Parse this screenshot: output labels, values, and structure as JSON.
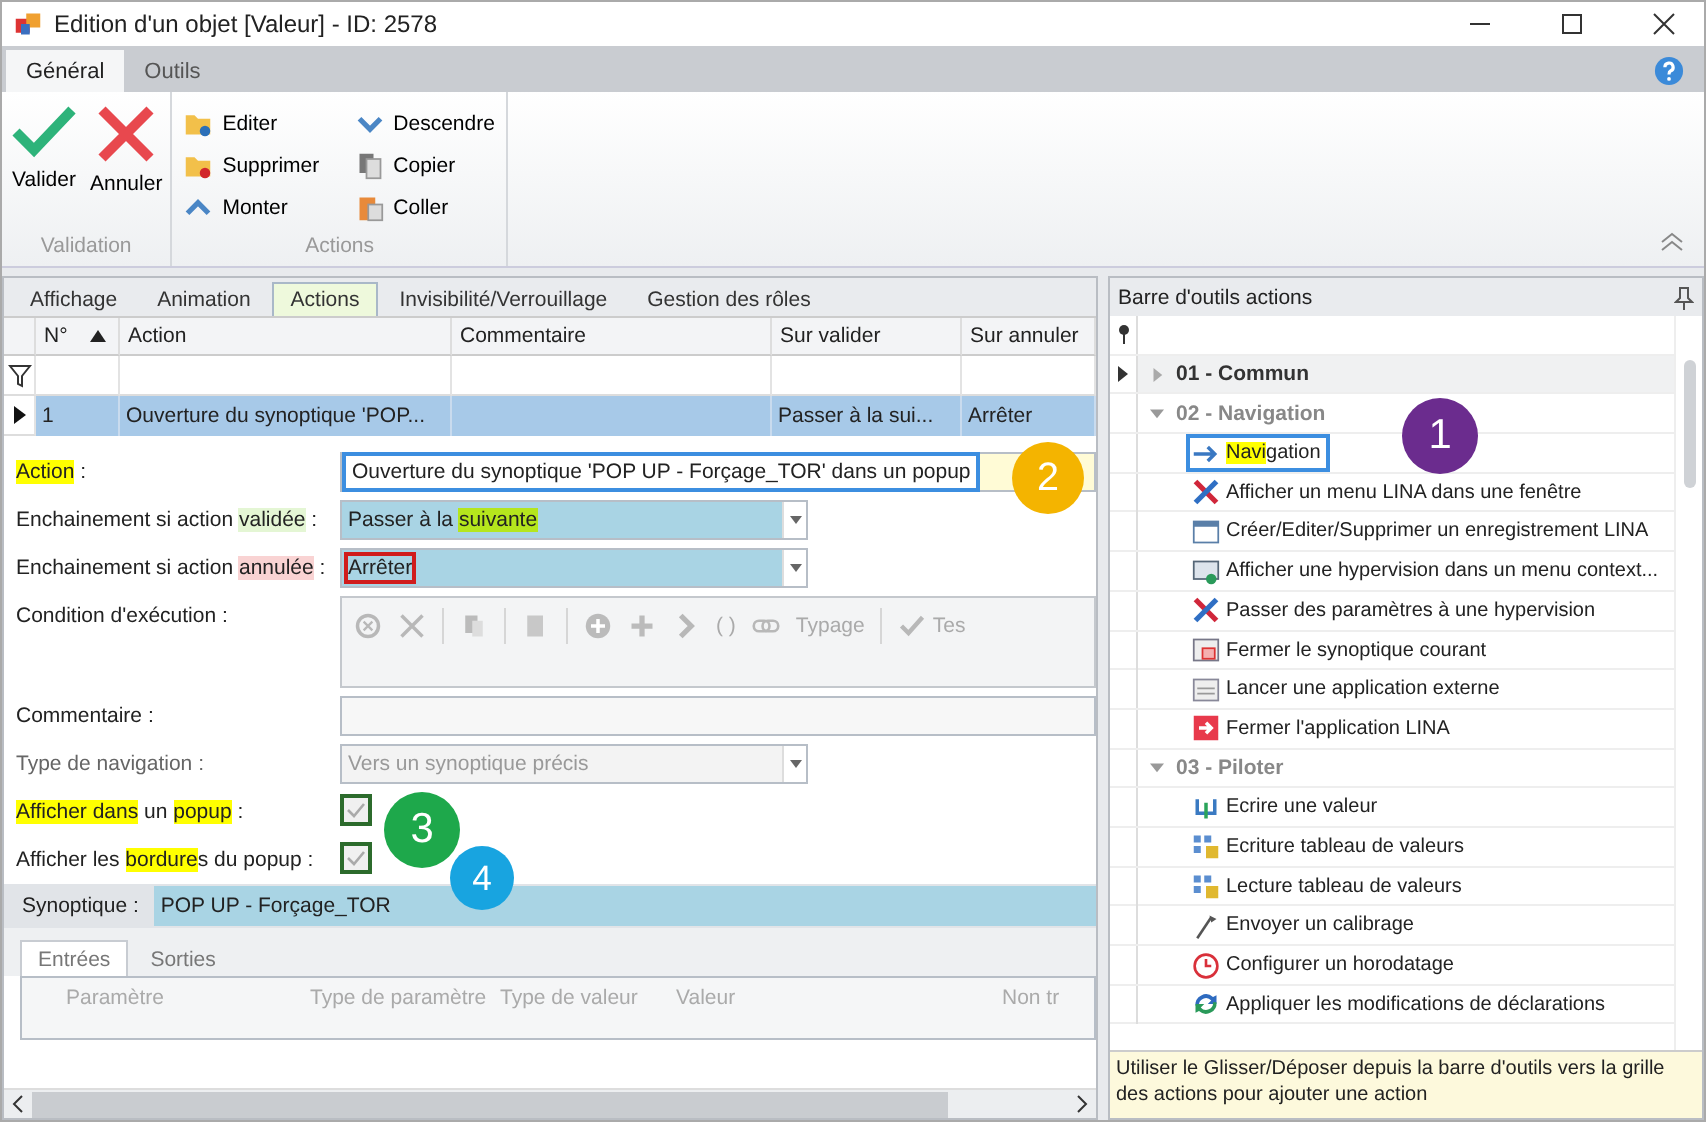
{
  "window": {
    "title": "Edition d'un objet [Valeur] - ID: 2578"
  },
  "ribbon": {
    "tabs": [
      {
        "label": "Général",
        "selected": true
      },
      {
        "label": "Outils",
        "selected": false
      }
    ],
    "groups": [
      {
        "label": "Validation",
        "kind": "large",
        "buttons": [
          {
            "label": "Valider",
            "kind": "check"
          },
          {
            "label": "Annuler",
            "kind": "cross"
          }
        ]
      },
      {
        "label": "Actions",
        "kind": "small",
        "buttons": [
          {
            "label": "Editer",
            "kind": "edit"
          },
          {
            "label": "Supprimer",
            "kind": "delete"
          },
          {
            "label": "Monter",
            "kind": "up"
          },
          {
            "label": "Descendre",
            "kind": "down"
          },
          {
            "label": "Copier",
            "kind": "copy"
          },
          {
            "label": "Coller",
            "kind": "paste"
          }
        ]
      }
    ]
  },
  "tabs": [
    {
      "label": "Affichage",
      "selected": false
    },
    {
      "label": "Animation",
      "selected": false
    },
    {
      "label": "Actions",
      "selected": true
    },
    {
      "label": "Invisibilité/Verrouillage",
      "selected": false
    },
    {
      "label": "Gestion des rôles",
      "selected": false
    }
  ],
  "grid": {
    "columns": [
      "N°",
      "Action",
      "Commentaire",
      "Sur valider",
      "Sur annuler"
    ],
    "rows": [
      {
        "selected": true,
        "cells": [
          "1",
          "Ouverture du synoptique 'POP...",
          "",
          "Passer à la sui...",
          "Arrêter"
        ]
      }
    ]
  },
  "form": [
    {
      "kind": "text",
      "label": [
        {
          "text": "Action",
          "color": "#ffff00"
        },
        {
          "text": " :"
        }
      ],
      "value": [
        {
          "text": "Ouverture du synoptique 'POP UP - Forçage_TOR' dans un popup"
        }
      ],
      "color": "#3c8ee0"
    },
    {
      "kind": "select",
      "label": [
        {
          "text": "Enchainement si action "
        },
        {
          "text": "validée",
          "color": "#e4f6d4"
        },
        {
          "text": " :"
        }
      ],
      "value": [
        {
          "text": "Passer à la "
        },
        {
          "text": "suivante",
          "color": "#b5e61d"
        }
      ],
      "disabled": false
    },
    {
      "kind": "select",
      "label": [
        {
          "text": "Enchainement si action "
        },
        {
          "text": "annulée",
          "color": "#f9d3d3"
        },
        {
          "text": " :"
        }
      ],
      "value": [
        {
          "text": "Arrêter",
          "kind": "frame",
          "color": "#d01c1c"
        }
      ],
      "disabled": false
    },
    {
      "kind": "toolbar",
      "label": [
        {
          "text": "Condition d'exécution :"
        }
      ],
      "tools": [
        {
          "kind": "clear"
        },
        {
          "kind": "x",
          "sep": true
        },
        {
          "kind": "copy",
          "sep": true
        },
        {
          "kind": "paste",
          "sep": true
        },
        {
          "kind": "pluscircle"
        },
        {
          "kind": "plus"
        },
        {
          "kind": "chevron"
        },
        {
          "kind": "text",
          "text": "( )"
        },
        {
          "kind": "link"
        },
        {
          "kind": "text",
          "text": "Typage",
          "sep": true
        },
        {
          "kind": "check",
          "text": "Tes"
        }
      ]
    },
    {
      "kind": "text",
      "label": [
        {
          "text": "Commentaire :"
        }
      ]
    },
    {
      "kind": "select",
      "label": [
        {
          "text": "Type de navigation :"
        }
      ],
      "value": [
        {
          "text": "Vers un synoptique précis"
        }
      ],
      "disabled": true
    },
    {
      "kind": "checkbox",
      "label": [
        {
          "text": "Afficher dans",
          "color": "#ffff00"
        },
        {
          "text": " un "
        },
        {
          "text": "popup",
          "color": "#ffff00"
        },
        {
          "text": " :"
        }
      ],
      "checked": true
    },
    {
      "kind": "checkbox",
      "label": [
        {
          "text": "Afficher les "
        },
        {
          "text": "bordure",
          "color": "#ffff00"
        },
        {
          "text": "s du popup :"
        }
      ],
      "checked": true
    }
  ],
  "synoptic": {
    "label": "Synoptique :",
    "value": "POP UP - Forçage_TOR"
  },
  "subtabs": [
    {
      "label": "Entrées",
      "selected": true
    },
    {
      "label": "Sorties",
      "selected": false
    }
  ],
  "subgrid": {
    "columns": [
      "Paramètre",
      "Type de paramètre",
      "Type de valeur",
      "Valeur",
      "Non tr"
    ]
  },
  "toolbox": {
    "title": "Barre d'outils actions",
    "groups": [
      {
        "label": "01 - Commun",
        "expanded": false
      },
      {
        "label": "02 - Navigation",
        "expanded": true,
        "items": [
          {
            "kind": "arrow",
            "label": [
              {
                "text": "Navi",
                "color": "#ffff00"
              },
              {
                "text": "gation"
              }
            ],
            "color": "#3c8ee0"
          },
          {
            "kind": "tools",
            "label": [
              {
                "text": "Afficher un menu LINA dans une fenêtre"
              }
            ]
          },
          {
            "kind": "form",
            "label": [
              {
                "text": "Créer/Editer/Supprimer un enregistrement LINA"
              }
            ]
          },
          {
            "kind": "screen",
            "label": [
              {
                "text": "Afficher une hypervision dans un menu context..."
              }
            ]
          },
          {
            "kind": "tools",
            "label": [
              {
                "text": "Passer des paramètres à une hypervision"
              }
            ]
          },
          {
            "kind": "close",
            "label": [
              {
                "text": "Fermer le synoptique courant"
              }
            ]
          },
          {
            "kind": "app",
            "label": [
              {
                "text": "Lancer une application externe"
              }
            ]
          },
          {
            "kind": "exit",
            "label": [
              {
                "text": "Fermer l'application LINA"
              }
            ]
          }
        ]
      },
      {
        "label": "03 - Piloter",
        "expanded": true,
        "items": [
          {
            "kind": "write",
            "label": [
              {
                "text": "Ecrire une valeur"
              }
            ]
          },
          {
            "kind": "table",
            "label": [
              {
                "text": "Ecriture tableau de valeurs"
              }
            ]
          },
          {
            "kind": "table",
            "label": [
              {
                "text": "Lecture tableau de valeurs"
              }
            ]
          },
          {
            "kind": "pen",
            "label": [
              {
                "text": "Envoyer un calibrage"
              }
            ]
          },
          {
            "kind": "clock",
            "label": [
              {
                "text": "Configurer un horodatage"
              }
            ]
          },
          {
            "kind": "sync",
            "label": [
              {
                "text": "Appliquer les modifications de déclarations"
              }
            ]
          }
        ]
      }
    ],
    "hint": "Utiliser le Glisser/Déposer depuis la barre d'outils vers la grille des actions pour ajouter une action"
  },
  "annotations": [
    {
      "text": "1",
      "color": "#6b2c8e"
    },
    {
      "text": "2",
      "color": "#f4b400"
    },
    {
      "text": "3",
      "color": "#1ea84b"
    },
    {
      "text": "4",
      "color": "#18a4e0"
    }
  ]
}
